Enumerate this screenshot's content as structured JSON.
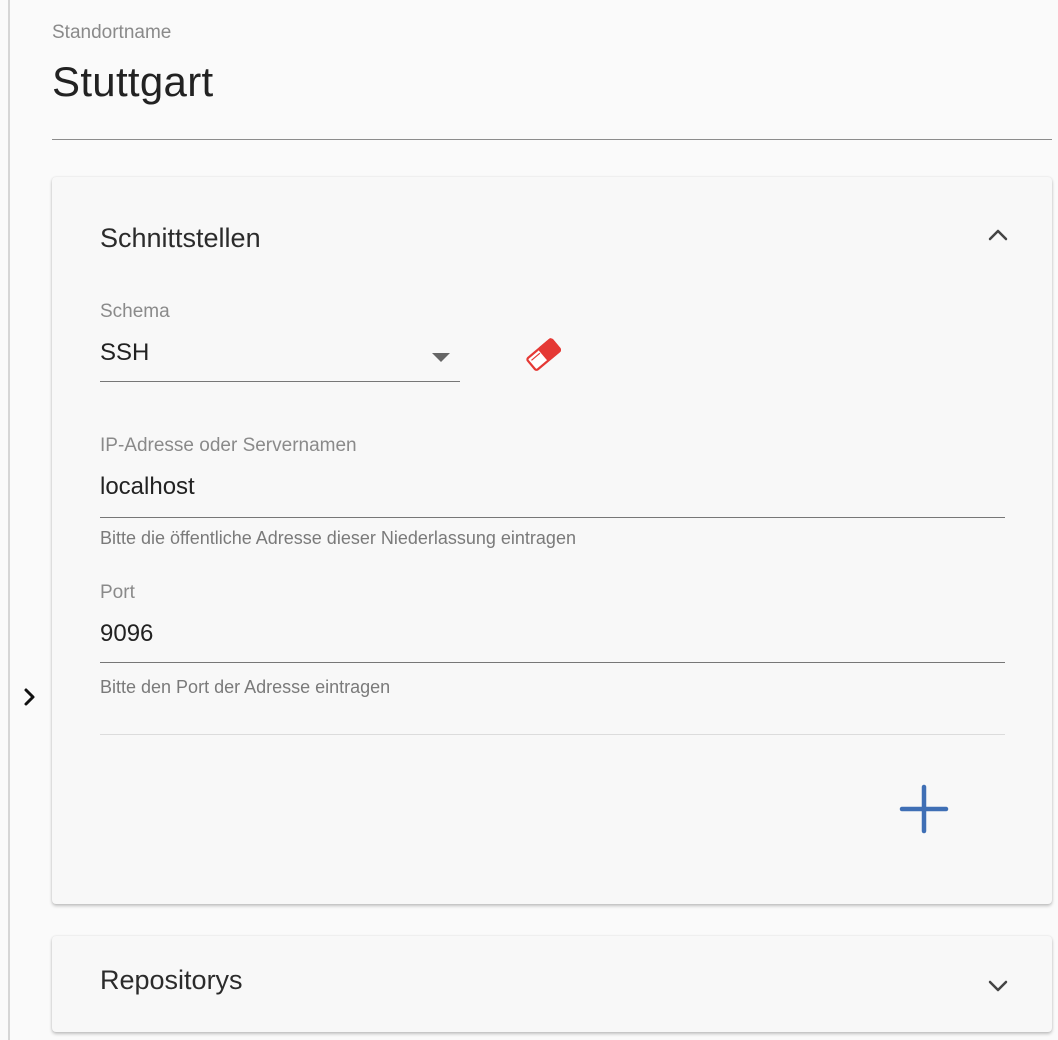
{
  "site": {
    "name_label": "Standortname",
    "name_value": "Stuttgart"
  },
  "interfaces_panel": {
    "title": "Schnittstellen",
    "expanded": true,
    "schema": {
      "label": "Schema",
      "value": "SSH"
    },
    "address": {
      "label": "IP-Adresse oder Servernamen",
      "value": "localhost",
      "hint": "Bitte die öffentliche Adresse dieser Niederlassung eintragen"
    },
    "port": {
      "label": "Port",
      "value": "9096",
      "hint": "Bitte den Port der Adresse eintragen"
    }
  },
  "repos_panel": {
    "title": "Repositorys",
    "expanded": false
  },
  "icons": {
    "expand": "chevron-right-icon",
    "collapse": "chevron-up-icon",
    "expand_down": "chevron-down-icon",
    "dropdown": "caret-down-icon",
    "clear": "eraser-icon",
    "add": "plus-icon"
  },
  "colors": {
    "eraser_red": "#e53935",
    "add_blue": "#3f6fb5",
    "text_primary": "#222222",
    "text_secondary": "#8a8a8a"
  }
}
